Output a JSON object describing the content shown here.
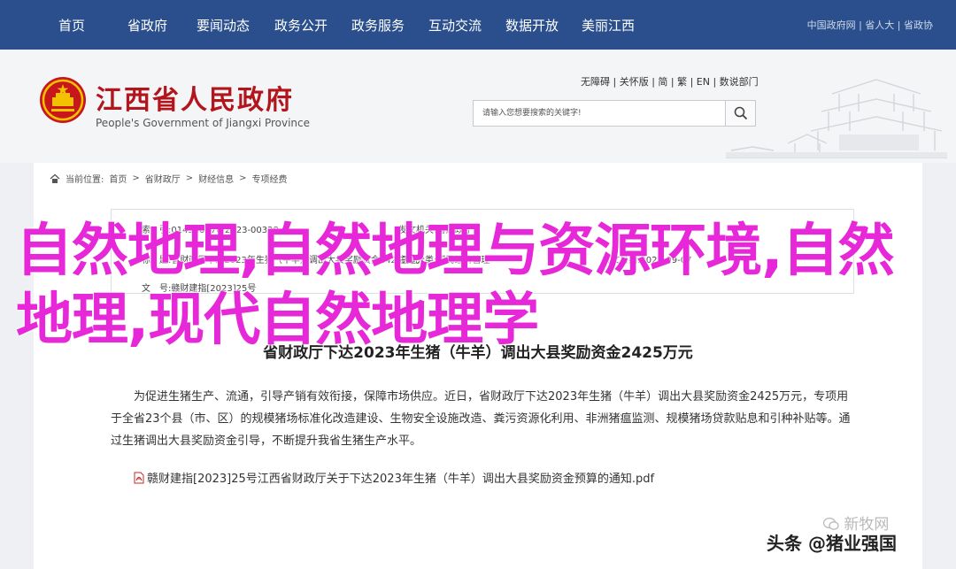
{
  "nav": {
    "items": [
      "首页",
      "省政府",
      "要闻动态",
      "政务公开",
      "政务服务",
      "互动交流",
      "数据开放",
      "美丽江西"
    ],
    "utility": "中国政府网 | 省人大 | 省政协"
  },
  "header": {
    "title": "江西省人民政府",
    "subtitle": "People's Government of Jiangxi Province",
    "access_links": "无障碍 | 关怀版 | 简 | 繁 | EN | 数说部门",
    "search_placeholder": "请输入您想要搜索的关键字!"
  },
  "breadcrumb": {
    "label": "当前位置:",
    "items": [
      "首页",
      "省财政厅",
      "财经信息",
      "专项经费"
    ],
    "separator": ">"
  },
  "info": {
    "index_no": "索　引:014500970/2023-00328",
    "publisher": "发文机关:省财政厅",
    "title_row": "标　题:省财政厅下达2023年生猪（牛羊）调出大县奖励资金2425万元",
    "doc_no": "文　号:赣财建指[2023]25号",
    "theme": "主题分类:国民经济管理",
    "date": "成文日期:2023-09-07"
  },
  "article": {
    "title": "省财政厅下达2023年生猪（牛羊）调出大县奖励资金2425万元",
    "body": "为促进生猪生产、流通，引导产销有效衔接，保障市场供应。近日，省财政厅下达2023年生猪（牛羊）调出大县奖励资金2425万元，专项用于全省23个县（市、区）的规模猪场标准化改造建设、生物安全设施改造、粪污资源化利用、非洲猪瘟监测、规模猪场贷款贴息和引种补贴等。通过生猪调出大县奖励资金引导，不断提升我省生猪生产水平。",
    "attachment": "赣财建指[2023]25号江西省财政厅关于下达2023年生猪（牛羊）调出大县奖励资金预算的通知.pdf"
  },
  "overlay": {
    "title": "自然地理,自然地理与资源环境,自然地理,现代自然地理学"
  },
  "watermark": {
    "source": "新牧网",
    "handle": "头条 @猪业强国"
  },
  "colors": {
    "nav_bg": "#2a4f8c",
    "title_red": "#b3151d",
    "overlay_magenta": "#e628d8"
  }
}
